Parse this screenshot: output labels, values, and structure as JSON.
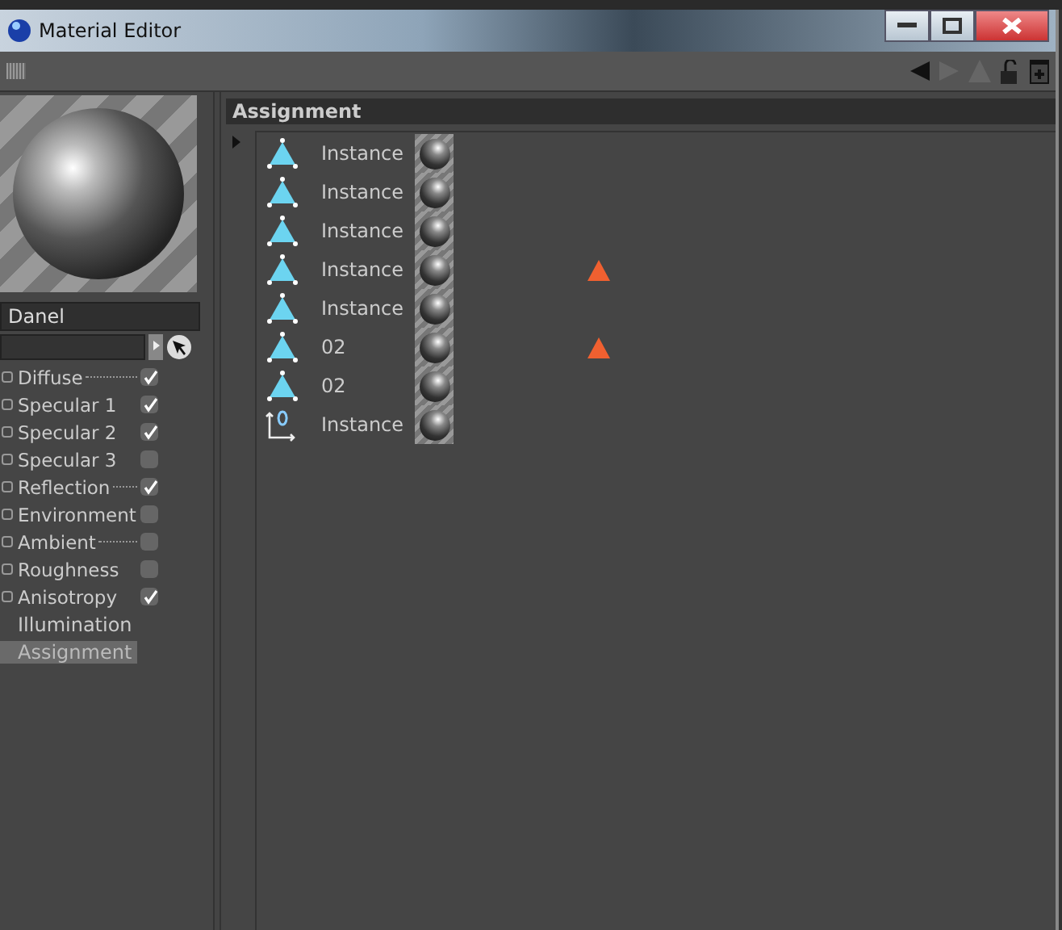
{
  "window": {
    "title": "Material Editor"
  },
  "material": {
    "name": "Danel"
  },
  "channels": [
    {
      "kind": "channel",
      "label": "Diffuse",
      "dotted": true,
      "checked": true
    },
    {
      "kind": "channel",
      "label": "Specular 1",
      "dotted": false,
      "checked": true
    },
    {
      "kind": "channel",
      "label": "Specular 2",
      "dotted": false,
      "checked": true
    },
    {
      "kind": "channel",
      "label": "Specular 3",
      "dotted": false,
      "checked": false
    },
    {
      "kind": "channel",
      "label": "Reflection",
      "dotted": true,
      "checked": true
    },
    {
      "kind": "channel",
      "label": "Environment",
      "dotted": false,
      "checked": false
    },
    {
      "kind": "channel",
      "label": "Ambient",
      "dotted": true,
      "checked": false
    },
    {
      "kind": "channel",
      "label": "Roughness",
      "dotted": false,
      "checked": false
    },
    {
      "kind": "channel",
      "label": "Anisotropy",
      "dotted": false,
      "checked": true
    },
    {
      "kind": "page",
      "label": "Illumination",
      "selected": false
    },
    {
      "kind": "page",
      "label": "Assignment",
      "selected": true
    }
  ],
  "assignment": {
    "title": "Assignment",
    "rows": [
      {
        "kind": "polygon",
        "name": "Instance",
        "warning": false
      },
      {
        "kind": "polygon",
        "name": "Instance",
        "warning": false
      },
      {
        "kind": "polygon",
        "name": "Instance",
        "warning": false
      },
      {
        "kind": "polygon",
        "name": "Instance",
        "warning": true
      },
      {
        "kind": "polygon",
        "name": "Instance",
        "warning": false
      },
      {
        "kind": "polygon",
        "name": "02",
        "warning": true
      },
      {
        "kind": "polygon",
        "name": "02",
        "warning": false
      },
      {
        "kind": "null",
        "name": "Instance",
        "warning": false
      }
    ]
  }
}
